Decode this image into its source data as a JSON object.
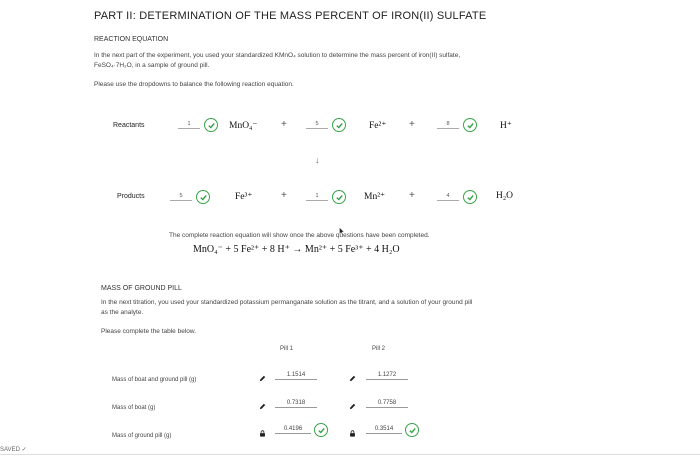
{
  "page_title": "PART II: DETERMINATION OF THE MASS PERCENT OF IRON(II) SULFATE",
  "reaction": {
    "heading": "REACTION EQUATION",
    "intro_1": "In the next part of the experiment, you used your standardized KMnO₄ solution to determine the mass percent of iron(II) sulfate,",
    "intro_2": "FeSO₄·7H₂O, in a sample of ground pill.",
    "instruction": "Please use the dropdowns to balance the following reaction equation.",
    "reactants_label": "Reactants",
    "products_label": "Products",
    "reactants": [
      {
        "coef": "1",
        "species": "MnO₄⁻"
      },
      {
        "coef": "5",
        "species": "Fe²⁺"
      },
      {
        "coef": "8",
        "species": "H⁺"
      }
    ],
    "products": [
      {
        "coef": "5",
        "species": "Fe³⁺"
      },
      {
        "coef": "1",
        "species": "Mn²⁺"
      },
      {
        "coef": "4",
        "species": "H₂O"
      }
    ],
    "plus": "+",
    "down_arrow": "↓",
    "complete_note": "The complete reaction equation will show once the above questions have been completed.",
    "complete_equation": "MnO₄⁻ + 5 Fe²⁺ + 8 H⁺ → Mn²⁺ + 5 Fe³⁺ + 4 H₂O"
  },
  "pill": {
    "heading": "MASS OF GROUND PILL",
    "intro_1": "In the next titration, you used your standardized potassium permanganate solution as the titrant, and a solution of your ground pill",
    "intro_2": "as the analyte.",
    "instruction": "Please complete the table below.",
    "columns": [
      "Pill 1",
      "Pill 2"
    ],
    "rows": [
      {
        "label": "Mass of boat and ground pill (g)",
        "values": [
          "1.1514",
          "1.1272"
        ],
        "mode": "edit"
      },
      {
        "label": "Mass of boat (g)",
        "values": [
          "0.7318",
          "0.7758"
        ],
        "mode": "edit"
      },
      {
        "label": "Mass of ground pill (g)",
        "values": [
          "0.4196",
          "0.3514"
        ],
        "mode": "locked"
      }
    ]
  },
  "status": {
    "saved": "SAVED"
  },
  "colors": {
    "check_green": "#3aa34a"
  }
}
